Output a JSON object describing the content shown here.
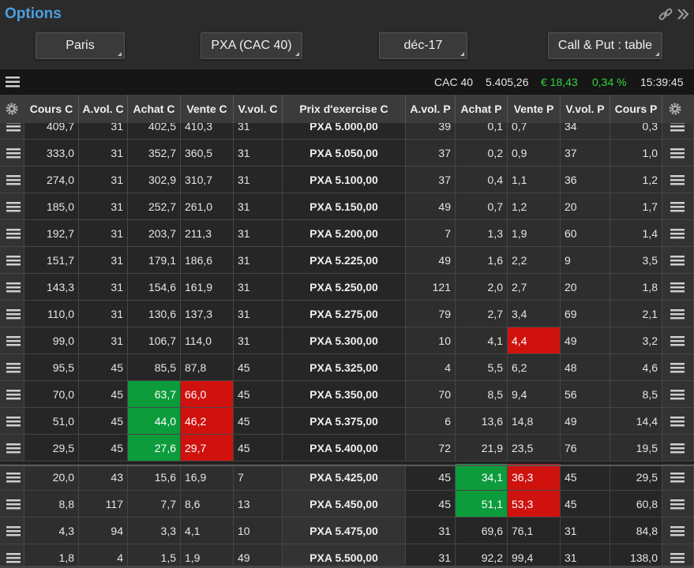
{
  "window": {
    "title": "Options"
  },
  "icons": {
    "link": "link-icon",
    "forward": "double-chevron-right-icon",
    "menu": "hamburger-menu-icon",
    "settings": "gear-icon"
  },
  "selectors": {
    "market": "Paris",
    "underlying": "PXA (CAC 40)",
    "expiry": "déc-17",
    "view": "Call & Put : table"
  },
  "status": {
    "index_name": "CAC 40",
    "index_value": "5.405,26",
    "change": "€ 18,43",
    "change_pct": "0,34 %",
    "time": "15:39:45"
  },
  "colors": {
    "title": "#4a9fe0",
    "positive": "#35d43b",
    "bid_highlight": "#0c9c3c",
    "ask_highlight": "#d0120f"
  },
  "columns": {
    "call_last": "Cours C",
    "call_ask_vol": "A.vol. C",
    "call_bid": "Achat C",
    "call_ask": "Vente C",
    "call_sell_vol": "V.vol. C",
    "strike": "Prix d'exercise C",
    "put_ask_vol": "A.vol. P",
    "put_bid": "Achat P",
    "put_ask": "Vente P",
    "put_sell_vol": "V.vol. P",
    "put_last": "Cours P"
  },
  "rows": [
    {
      "cl": "409,7",
      "cav": "31",
      "cb": "402,5",
      "ca": "410,3",
      "cvv": "31",
      "strike": "PXA 5.000,00",
      "pav": "39",
      "pb": "0,1",
      "pa": "0,7",
      "pvv": "34",
      "pl": "0,3"
    },
    {
      "cl": "333,0",
      "cav": "31",
      "cb": "352,7",
      "ca": "360,5",
      "cvv": "31",
      "strike": "PXA 5.050,00",
      "pav": "37",
      "pb": "0,2",
      "pa": "0,9",
      "pvv": "37",
      "pl": "1,0"
    },
    {
      "cl": "274,0",
      "cav": "31",
      "cb": "302,9",
      "ca": "310,7",
      "cvv": "31",
      "strike": "PXA 5.100,00",
      "pav": "37",
      "pb": "0,4",
      "pa": "1,1",
      "pvv": "36",
      "pl": "1,2"
    },
    {
      "cl": "185,0",
      "cav": "31",
      "cb": "252,7",
      "ca": "261,0",
      "cvv": "31",
      "strike": "PXA 5.150,00",
      "pav": "49",
      "pb": "0,7",
      "pa": "1,2",
      "pvv": "20",
      "pl": "1,7"
    },
    {
      "cl": "192,7",
      "cav": "31",
      "cb": "203,7",
      "ca": "211,3",
      "cvv": "31",
      "strike": "PXA 5.200,00",
      "pav": "7",
      "pb": "1,3",
      "pa": "1,9",
      "pvv": "60",
      "pl": "1,4"
    },
    {
      "cl": "151,7",
      "cav": "31",
      "cb": "179,1",
      "ca": "186,6",
      "cvv": "31",
      "strike": "PXA 5.225,00",
      "pav": "49",
      "pb": "1,6",
      "pa": "2,2",
      "pvv": "9",
      "pl": "3,5"
    },
    {
      "cl": "143,3",
      "cav": "31",
      "cb": "154,6",
      "ca": "161,9",
      "cvv": "31",
      "strike": "PXA 5.250,00",
      "pav": "121",
      "pb": "2,0",
      "pa": "2,7",
      "pvv": "20",
      "pl": "1,8"
    },
    {
      "cl": "110,0",
      "cav": "31",
      "cb": "130,6",
      "ca": "137,3",
      "cvv": "31",
      "strike": "PXA 5.275,00",
      "pav": "79",
      "pb": "2,7",
      "pa": "3,4",
      "pvv": "69",
      "pl": "2,1"
    },
    {
      "cl": "99,0",
      "cav": "31",
      "cb": "106,7",
      "ca": "114,0",
      "cvv": "31",
      "strike": "PXA 5.300,00",
      "pav": "10",
      "pb": "4,1",
      "pa": "4,4",
      "pvv": "49",
      "pl": "3,2"
    },
    {
      "cl": "95,5",
      "cav": "45",
      "cb": "85,5",
      "ca": "87,8",
      "cvv": "45",
      "strike": "PXA 5.325,00",
      "pav": "4",
      "pb": "5,5",
      "pa": "6,2",
      "pvv": "48",
      "pl": "4,6"
    },
    {
      "cl": "70,0",
      "cav": "45",
      "cb": "63,7",
      "ca": "66,0",
      "cvv": "45",
      "strike": "PXA 5.350,00",
      "pav": "70",
      "pb": "8,5",
      "pa": "9,4",
      "pvv": "56",
      "pl": "8,5"
    },
    {
      "cl": "51,0",
      "cav": "45",
      "cb": "44,0",
      "ca": "46,2",
      "cvv": "45",
      "strike": "PXA 5.375,00",
      "pav": "6",
      "pb": "13,6",
      "pa": "14,8",
      "pvv": "49",
      "pl": "14,4"
    },
    {
      "cl": "29,5",
      "cav": "45",
      "cb": "27,6",
      "ca": "29,7",
      "cvv": "45",
      "strike": "PXA 5.400,00",
      "pav": "72",
      "pb": "21,9",
      "pa": "23,5",
      "pvv": "76",
      "pl": "19,5"
    },
    {
      "cl": "20,0",
      "cav": "43",
      "cb": "15,6",
      "ca": "16,9",
      "cvv": "7",
      "strike": "PXA 5.425,00",
      "pav": "45",
      "pb": "34,1",
      "pa": "36,3",
      "pvv": "45",
      "pl": "29,5"
    },
    {
      "cl": "8,8",
      "cav": "117",
      "cb": "7,7",
      "ca": "8,6",
      "cvv": "13",
      "strike": "PXA 5.450,00",
      "pav": "45",
      "pb": "51,1",
      "pa": "53,3",
      "pvv": "45",
      "pl": "60,8"
    },
    {
      "cl": "4,3",
      "cav": "94",
      "cb": "3,3",
      "ca": "4,1",
      "cvv": "10",
      "strike": "PXA 5.475,00",
      "pav": "31",
      "pb": "69,6",
      "pa": "76,1",
      "pvv": "31",
      "pl": "84,8"
    },
    {
      "cl": "1,8",
      "cav": "4",
      "cb": "1,5",
      "ca": "1,9",
      "cvv": "49",
      "strike": "PXA 5.500,00",
      "pav": "31",
      "pb": "92,2",
      "pa": "99,4",
      "pvv": "31",
      "pl": "138,0"
    }
  ]
}
